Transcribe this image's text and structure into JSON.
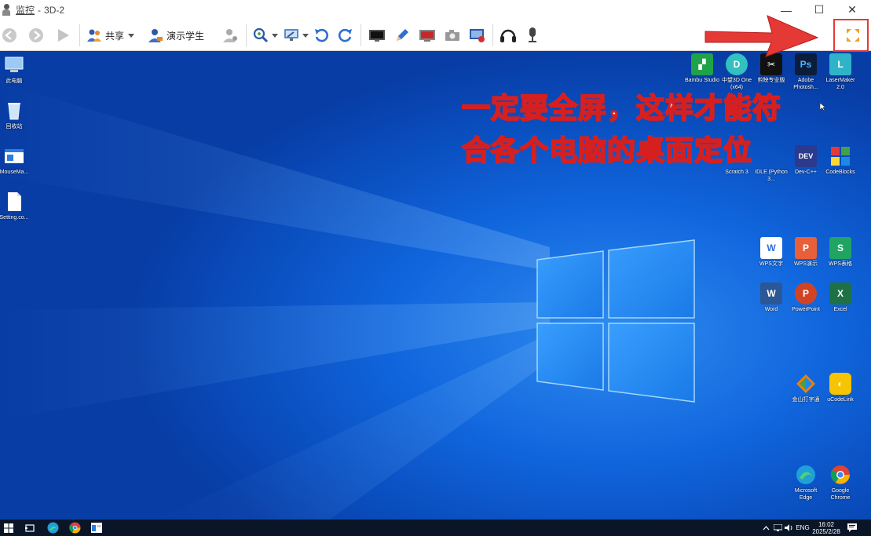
{
  "window": {
    "title": "监控",
    "subtitle": "3D-2",
    "controls": {
      "minimize": "—",
      "maximize": "☐",
      "close": "✕"
    }
  },
  "toolbar": {
    "share_label": "共享",
    "demo_student_label": "演示学生"
  },
  "annotation": {
    "line1": "一定要全屏，这样才能符",
    "line2": "合各个电脑的桌面定位"
  },
  "desktop": {
    "left_icons": [
      {
        "label": "此电脑"
      },
      {
        "label": "回收站"
      },
      {
        "label": "MouseMa..."
      },
      {
        "label": "Setting.co..."
      }
    ],
    "right_icons": [
      {
        "label": "Bambu Studio"
      },
      {
        "label": "中望3D One (x64)"
      },
      {
        "label": "剪映专业版"
      },
      {
        "label": "Adobe Photosh..."
      },
      {
        "label": "LaserMaker 2.0"
      },
      {
        "label": "Scratch 3"
      },
      {
        "label": "IDLE (Python 3..."
      },
      {
        "label": "Dev-C++"
      },
      {
        "label": "CodeBlocks"
      },
      {
        "label": "WPS文字"
      },
      {
        "label": "WPS演示"
      },
      {
        "label": "WPS表格"
      },
      {
        "label": "Word"
      },
      {
        "label": "PowerPoint"
      },
      {
        "label": "Excel"
      },
      {
        "label": "金山打字通"
      },
      {
        "label": "uCodeLink"
      },
      {
        "label": "Microsoft Edge"
      },
      {
        "label": "Google Chrome"
      }
    ]
  },
  "taskbar": {
    "lang": "ENG",
    "time": "16:02",
    "date": "2025/2/28"
  },
  "colors": {
    "annotation_red": "#e53935",
    "desktop_blue": "#1166dd",
    "taskbar": "#0a1628"
  }
}
